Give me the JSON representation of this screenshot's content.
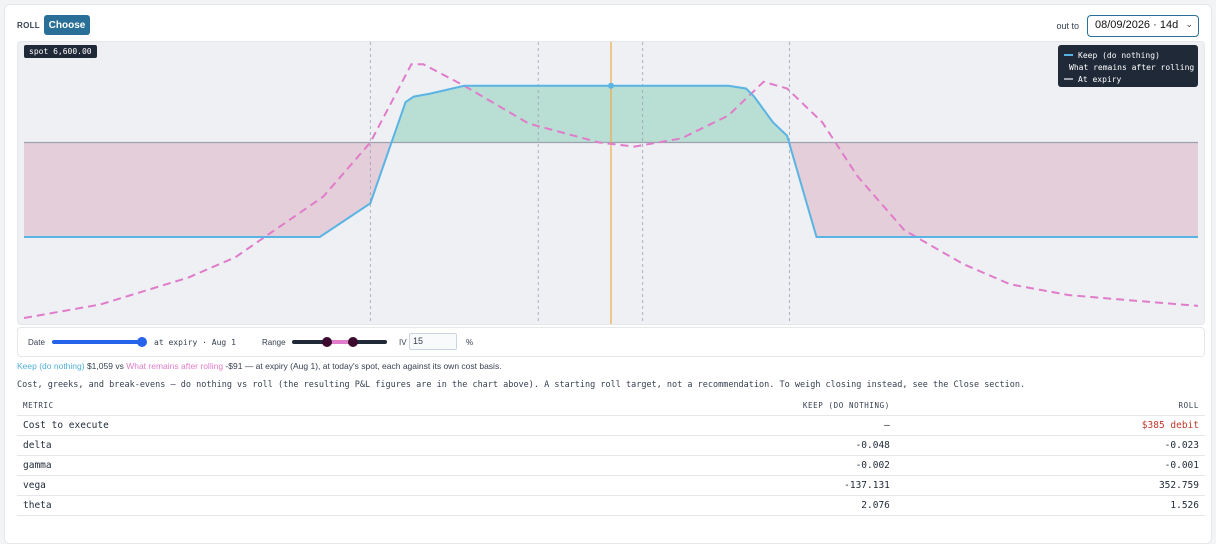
{
  "header": {
    "section_label": "ROLL",
    "choose_label": "Choose",
    "out_to_label": "out to",
    "date_value": "08/09/2026 · 14d"
  },
  "chart_data": {
    "type": "line",
    "spot_label": "spot 6,600.00",
    "legend": [
      {
        "name": "Keep (do nothing)",
        "color": "#5ab4e3",
        "style": "solid"
      },
      {
        "name": "What remains after rolling",
        "color": "#e07cc9",
        "style": "dashed"
      },
      {
        "name": "At expiry",
        "color": "#9ca3af",
        "style": "dashed"
      }
    ],
    "xlim": [
      0,
      100
    ],
    "ylim": [
      -100,
      100
    ],
    "spot_x": 50,
    "reference_lines_x": [
      29.5,
      43.8,
      52.7,
      65.2
    ],
    "expiry_level": 30,
    "keep": {
      "x": [
        0,
        25.2,
        29.5,
        32.5,
        33.2,
        34.5,
        37.5,
        60,
        61.5,
        62.2,
        63.8,
        65,
        67.5,
        100
      ],
      "y": [
        -40,
        -40,
        -15,
        60,
        64,
        66,
        72,
        72,
        70,
        64,
        45,
        35,
        -40,
        -40
      ]
    },
    "remaining": {
      "x": [
        0,
        6.5,
        14,
        18,
        25.5,
        29.5,
        33,
        34,
        37.5,
        43,
        49,
        52,
        56,
        60,
        63,
        65,
        68,
        71,
        75,
        80,
        84,
        89,
        93,
        100
      ],
      "y": [
        -100,
        -90,
        -70,
        -55,
        -10,
        30,
        88,
        88,
        72,
        44,
        30,
        27,
        33,
        50,
        75,
        70,
        45,
        5,
        -35,
        -60,
        -75,
        -83,
        -86,
        -91
      ]
    }
  },
  "controls": {
    "date_label": "Date",
    "date_value": "at expiry · Aug 1",
    "date_fraction": 1.0,
    "range_label": "Range",
    "range_low": 0.36,
    "range_high": 0.64,
    "iv_label": "IV",
    "iv_value": "15",
    "iv_unit": "%"
  },
  "summary": {
    "keep_label": "Keep (do nothing)",
    "keep_value": "$1,059",
    "vs": "vs",
    "remaining_label": "What remains after rolling",
    "remaining_value": "-$91",
    "rest": "— at expiry (Aug 1), at today's spot, each against its own cost basis."
  },
  "description": "Cost, greeks, and break-evens — do nothing vs roll (the resulting P&L figures are in the chart above). A starting roll target, not a recommendation. To weigh closing instead, see the Close section.",
  "table": {
    "headers": [
      "METRIC",
      "KEEP (DO NOTHING)",
      "ROLL"
    ],
    "rows": [
      {
        "metric": "Cost to execute",
        "keep": "—",
        "roll": "$385 debit"
      },
      {
        "metric": "delta",
        "keep": "-0.048",
        "roll": "-0.023"
      },
      {
        "metric": "gamma",
        "keep": "-0.002",
        "roll": "-0.001"
      },
      {
        "metric": "vega",
        "keep": "-137.131",
        "roll": "352.759"
      },
      {
        "metric": "theta",
        "keep": "2.076",
        "roll": "1.526"
      }
    ]
  }
}
